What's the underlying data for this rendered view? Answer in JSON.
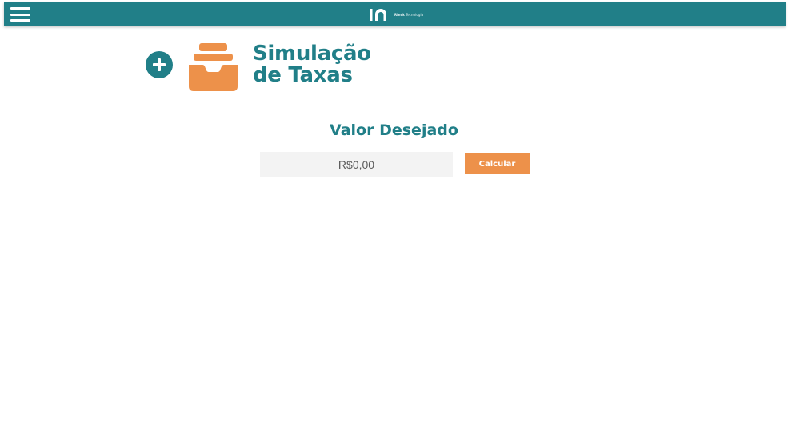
{
  "header": {
    "brand": {
      "name": "Rinck",
      "tagline": "Tecnologia"
    },
    "menu_icon": "hamburger-menu-icon",
    "color": "#217f88"
  },
  "page": {
    "title_line1": "Simulação",
    "title_line2": "de Taxas",
    "add_icon": "plus-circle-icon",
    "section_icon": "inbox-tray-icon"
  },
  "form": {
    "label": "Valor Desejado",
    "amount_placeholder": "R$0,00",
    "amount_value": "",
    "submit_label": "Calcular"
  },
  "colors": {
    "primary": "#217f88",
    "accent": "#ed914a",
    "input_bg": "#f3f3f3"
  }
}
